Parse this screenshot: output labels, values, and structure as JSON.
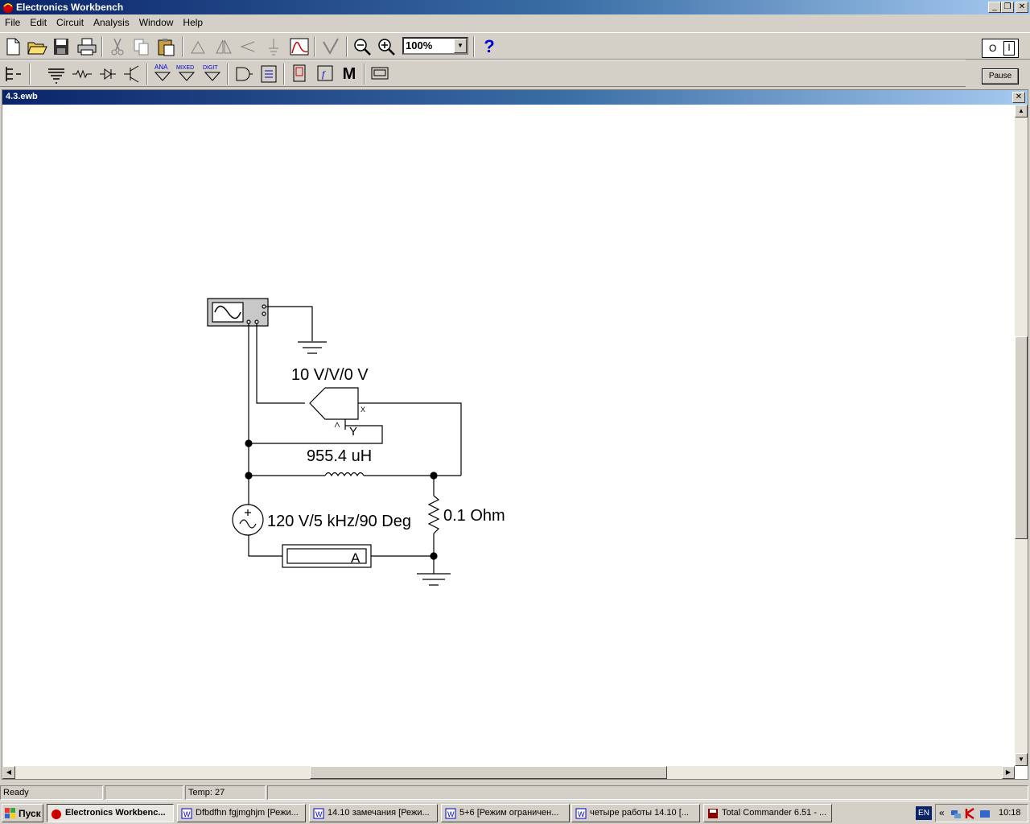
{
  "app": {
    "title": "Electronics Workbench"
  },
  "menu": [
    "File",
    "Edit",
    "Circuit",
    "Analysis",
    "Window",
    "Help"
  ],
  "toolbar": {
    "zoom_value": "100%",
    "help_label": "?"
  },
  "parts_bin": {
    "ana_label": "ANA",
    "mixed_label": "MIXED",
    "digit_label": "DIGIT",
    "m_label": "M"
  },
  "power": {
    "pause_label": "Pause",
    "switch_off": "O",
    "switch_on": "I"
  },
  "document": {
    "title": "4.3.ewb"
  },
  "circuit": {
    "multimeter_setting": "10 V/V/0 V",
    "multimeter_x": "X",
    "multimeter_y": "Y",
    "inductor_value": "955.4 uH",
    "source_value": "120 V/5 kHz/90 Deg",
    "resistor_value": "0.1  Ohm",
    "ammeter_label": "A"
  },
  "status": {
    "state": "Ready",
    "field2": "",
    "temp": "Temp:  27"
  },
  "taskbar": {
    "start_label": "Пуск",
    "tasks": [
      "Electronics Workbenc...",
      "Dfbdfhn fgjmghjm [Режи...",
      "14.10 замечания [Режи...",
      "5+6 [Режим ограничен...",
      "четыре работы 14.10 [...",
      "Total Commander 6.51 - ..."
    ],
    "lang": "EN",
    "clock": "10:18"
  },
  "colors": {
    "title_active": "#0a246a",
    "face": "#d4d0c8",
    "canvas": "#ffffff"
  }
}
